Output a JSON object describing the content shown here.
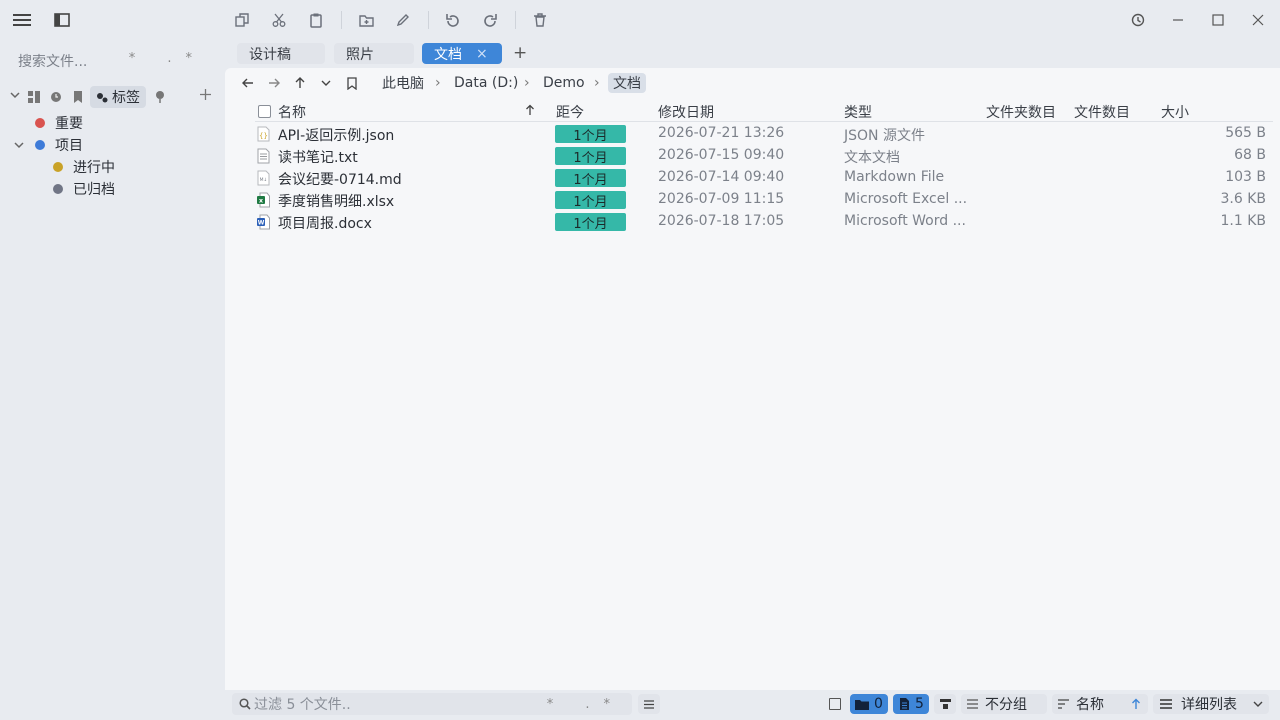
{
  "sidebar": {
    "search_placeholder": "搜索文件...",
    "search_opts": "* .*",
    "active_tab_label": "标签",
    "tags": [
      {
        "label": "重要",
        "color": "#d9534f"
      },
      {
        "label": "项目",
        "color": "#3e7bd8"
      },
      {
        "label": "进行中",
        "color": "#c9a227"
      },
      {
        "label": "已归档",
        "color": "#707585"
      }
    ]
  },
  "tabs": [
    {
      "label": "设计稿"
    },
    {
      "label": "照片"
    },
    {
      "label": "文档",
      "close": "×"
    }
  ],
  "new_tab": "+",
  "breadcrumb": [
    "此电脑",
    "Data (D:)",
    "Demo",
    "文档"
  ],
  "columns": {
    "name": "名称",
    "age": "距今",
    "modified": "修改日期",
    "type": "类型",
    "folders": "文件夹数目",
    "files": "文件数目",
    "size": "大小"
  },
  "files": [
    {
      "name": "API-返回示例.json",
      "age": "1个月",
      "modified": "2026-07-21 13:26",
      "type": "JSON 源文件",
      "size": "565 B",
      "icon": "json-file-icon"
    },
    {
      "name": "读书笔记.txt",
      "age": "1个月",
      "modified": "2026-07-15 09:40",
      "type": "文本文档",
      "size": "68 B",
      "icon": "text-file-icon"
    },
    {
      "name": "会议纪要-0714.md",
      "age": "1个月",
      "modified": "2026-07-14 09:40",
      "type": "Markdown File",
      "size": "103 B",
      "icon": "markdown-file-icon"
    },
    {
      "name": "季度销售明细.xlsx",
      "age": "1个月",
      "modified": "2026-07-09 11:15",
      "type": "Microsoft Excel ...",
      "size": "3.6 KB",
      "icon": "excel-file-icon"
    },
    {
      "name": "项目周报.docx",
      "age": "1个月",
      "modified": "2026-07-18 17:05",
      "type": "Microsoft Word ...",
      "size": "1.1 KB",
      "icon": "word-file-icon"
    }
  ],
  "footer": {
    "filter_placeholder": "过滤 5 个文件..",
    "filter_opts": "* .*",
    "folder_count": "0",
    "file_count": "5",
    "group_label": "不分组",
    "sort_label": "名称",
    "view_label": "详细列表"
  },
  "colors": {
    "accent": "#3e86d8",
    "age_badge": "#35b8a8"
  }
}
